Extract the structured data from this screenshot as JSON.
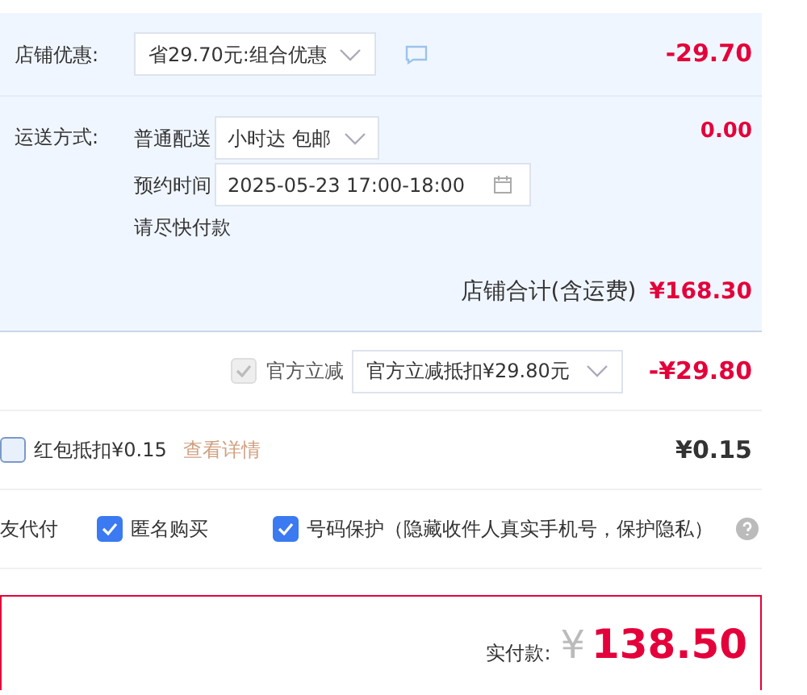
{
  "shop_discount": {
    "label": "店铺优惠:",
    "select": "省29.70元:组合优惠",
    "amount": "-29.70"
  },
  "shipping": {
    "label": "运送方式:",
    "method_label": "普通配送",
    "method": "小时达 包邮",
    "time_label": "预约时间",
    "time": "2025-05-23 17:00-18:00",
    "note": "请尽快付款",
    "amount": "0.00"
  },
  "shop_total": {
    "label": "店铺合计(含运费)",
    "amount": "¥168.30"
  },
  "official_discount": {
    "checked": true,
    "disabled": true,
    "label": "官方立减",
    "select": "官方立减抵扣¥29.80元",
    "amount": "-¥29.80"
  },
  "red_packet": {
    "checked": false,
    "label": "红包抵扣¥0.15",
    "link": "查看详情",
    "amount": "¥0.15"
  },
  "options": [
    {
      "kind": "text",
      "label": "友代付"
    },
    {
      "kind": "checkbox",
      "label": "匿名购买",
      "checked": true
    },
    {
      "kind": "checkbox",
      "label": "号码保护（隐藏收件人真实手机号，保护隐私）",
      "checked": true,
      "help": true
    }
  ],
  "payment": {
    "label": "实付款:",
    "currency": "¥",
    "amount": "138.50"
  }
}
